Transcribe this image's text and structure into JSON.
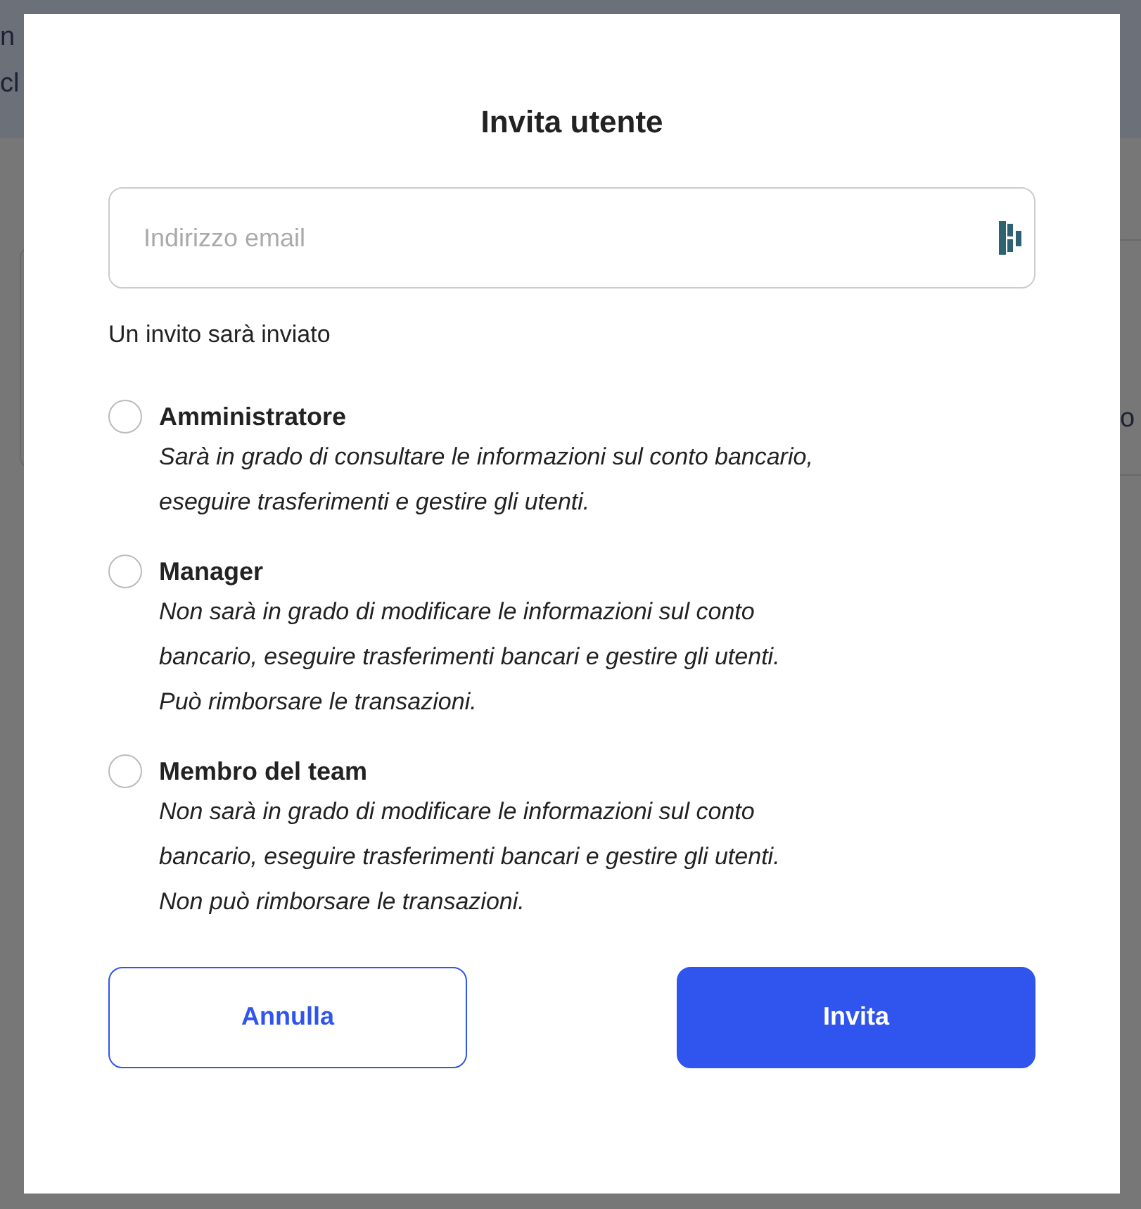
{
  "background": {
    "fragments": [
      "n",
      "cl",
      "o"
    ]
  },
  "dialog": {
    "title": "Invita utente",
    "email": {
      "placeholder": "Indirizzo email"
    },
    "note": "Un invito sarà inviato",
    "roles": [
      {
        "label": "Amministratore",
        "selected": false,
        "description": [
          "Sarà in grado di consultare le informazioni sul conto bancario,",
          "eseguire trasferimenti e gestire gli utenti."
        ]
      },
      {
        "label": "Manager",
        "selected": false,
        "description": [
          "Non sarà in grado di modificare le informazioni sul conto",
          "bancario, eseguire trasferimenti bancari e gestire gli utenti.",
          "Può rimborsare le transazioni."
        ]
      },
      {
        "label": "Membro del team",
        "selected": false,
        "description": [
          "Non sarà in grado di modificare le informazioni sul conto",
          "bancario, eseguire trasferimenti bancari e gestire gli utenti.",
          "Non può rimborsare le transazioni."
        ]
      }
    ],
    "buttons": [
      {
        "kind": "secondary",
        "label": "Annulla"
      },
      {
        "kind": "primary",
        "label": "Invita"
      }
    ]
  }
}
